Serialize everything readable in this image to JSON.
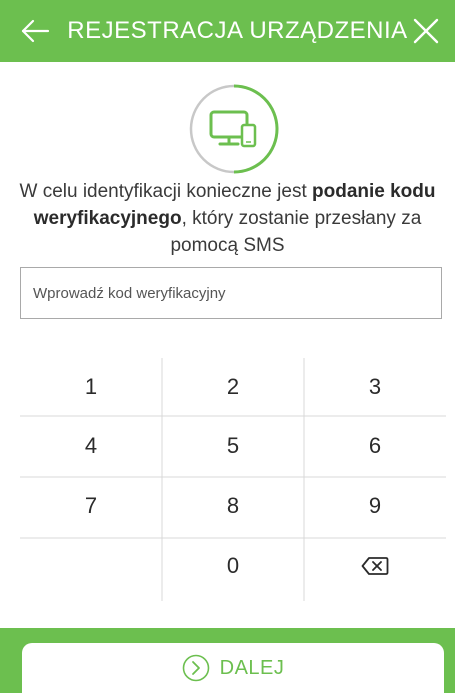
{
  "header": {
    "title": "REJESTRACJA URZĄDZENIA",
    "back_icon": "arrow-left-icon",
    "close_icon": "close-icon"
  },
  "device_icon": "monitor-phone-icon",
  "description": {
    "part1": "W celu identyfikacji konieczne jest ",
    "bold": "podanie kodu weryfikacyjnego",
    "part2": ", który zostanie przesłany za pomocą SMS"
  },
  "input": {
    "placeholder": "Wprowadź kod weryfikacyjny",
    "value": ""
  },
  "keypad": {
    "rows": [
      [
        "1",
        "2",
        "3"
      ],
      [
        "4",
        "5",
        "6"
      ],
      [
        "7",
        "8",
        "9"
      ],
      [
        "",
        "0",
        "backspace-icon"
      ]
    ]
  },
  "next_button": {
    "label": "DALEJ",
    "icon": "chevron-circle-right-icon"
  },
  "colors": {
    "brand_green": "#6cbf4f",
    "text": "#3a3a3a",
    "divider": "#d9d9d9"
  }
}
